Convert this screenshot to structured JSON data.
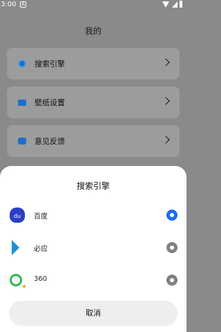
{
  "status": {
    "time": "3:00",
    "notif_glyph": "A"
  },
  "page": {
    "title": "我的"
  },
  "menu": [
    {
      "label": "搜索引擎",
      "icon": "search-engine-icon"
    },
    {
      "label": "壁纸设置",
      "icon": "wallpaper-icon"
    },
    {
      "label": "意见反馈",
      "icon": "feedback-icon"
    }
  ],
  "sheet": {
    "title": "搜索引擎",
    "engines": [
      {
        "label": "百度",
        "logo": "baidu-logo-icon",
        "logo_text": "du",
        "selected": true
      },
      {
        "label": "必应",
        "logo": "bing-logo-icon",
        "selected": false
      },
      {
        "label": "360",
        "logo": "360-logo-icon",
        "selected": false
      }
    ],
    "cancel_label": "取消"
  },
  "colors": {
    "accent": "#1a6cf0",
    "overlay": "#8a8a8a",
    "sheet_bg": "#ffffff"
  }
}
